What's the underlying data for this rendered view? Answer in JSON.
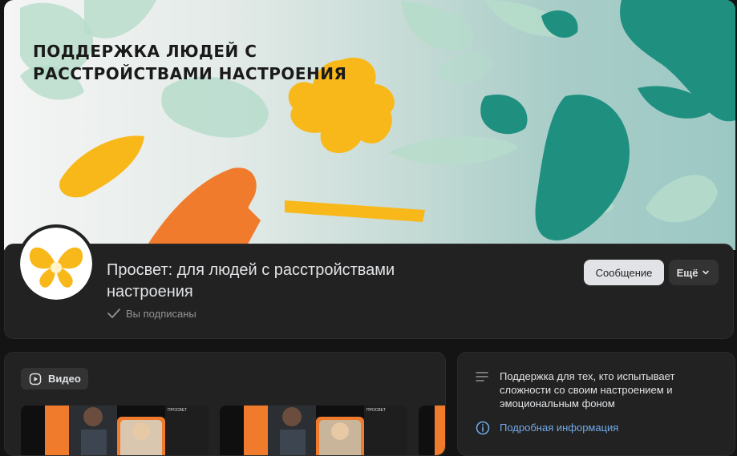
{
  "cover": {
    "title": "ПОДДЕРЖКА ЛЮДЕЙ С\nРАССТРОЙСТВАМИ НАСТРОЕНИЯ"
  },
  "group": {
    "name": "Просвет: для людей с расстройствами настроения",
    "status": "Вы подписаны"
  },
  "actions": {
    "message_label": "Сообщение",
    "more_label": "Ещё"
  },
  "video": {
    "tab_label": "Видео",
    "thumb_brand": "ПРОСВЕТ"
  },
  "info": {
    "description": "Поддержка для тех, кто испытывает сложности со своим настроением и эмоциональным фоном",
    "more_link": "Подробная информация"
  },
  "colors": {
    "accent_blue": "#71aaeb",
    "teal": "#1f8f80",
    "yellow": "#f8b81a",
    "orange": "#f07b2c",
    "mint": "#b6dccb"
  }
}
